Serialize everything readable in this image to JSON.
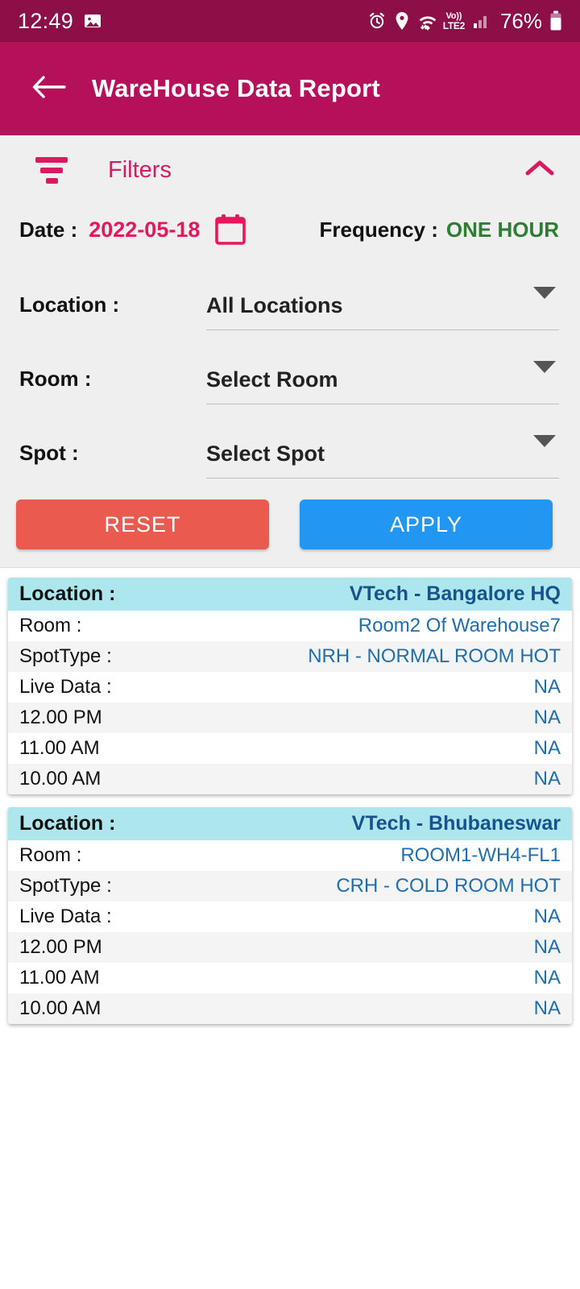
{
  "status_bar": {
    "time": "12:49",
    "icons_left": [
      "image-icon"
    ],
    "icons_right": [
      "alarm-icon",
      "location-pin-icon",
      "wifi-icon",
      "volte-icon",
      "signal-bars-icon",
      "battery-icon"
    ],
    "volte_top": "Vo))",
    "volte_bottom": "LTE2",
    "battery_percent": "76%"
  },
  "app_bar": {
    "back_icon": "back-arrow-icon",
    "title": "WareHouse Data Report",
    "background": "#B5115A"
  },
  "filters": {
    "icon": "filter-icon",
    "title": "Filters",
    "collapse_icon": "chevron-up-icon",
    "date": {
      "label": "Date :",
      "value": "2022-05-18",
      "icon": "calendar-icon",
      "color": "#E8175D"
    },
    "frequency": {
      "label": "Frequency :",
      "value": "ONE HOUR",
      "color": "#2E7D32"
    },
    "selects": [
      {
        "label": "Location :",
        "value": "All Locations",
        "caret": "caret-down-icon"
      },
      {
        "label": "Room :",
        "value": "Select Room",
        "caret": "caret-down-icon"
      },
      {
        "label": "Spot :",
        "value": "Select Spot",
        "caret": "caret-down-icon"
      }
    ],
    "buttons": {
      "reset": "RESET",
      "apply": "APPLY",
      "reset_color": "#EB5A4E",
      "apply_color": "#2196F3"
    }
  },
  "results": {
    "cards": [
      {
        "header": {
          "key": "Location :",
          "value": "VTech - Bangalore HQ"
        },
        "rows": [
          {
            "key": "Room :",
            "value": "Room2 Of Warehouse7"
          },
          {
            "key": "SpotType :",
            "value": "NRH - NORMAL ROOM HOT"
          },
          {
            "key": "Live Data :",
            "value": "NA"
          },
          {
            "key": "12.00 PM",
            "value": "NA"
          },
          {
            "key": "11.00 AM",
            "value": "NA"
          },
          {
            "key": "10.00 AM",
            "value": "NA"
          }
        ]
      },
      {
        "header": {
          "key": "Location :",
          "value": "VTech - Bhubaneswar"
        },
        "rows": [
          {
            "key": "Room :",
            "value": "ROOM1-WH4-FL1"
          },
          {
            "key": "SpotType :",
            "value": "CRH - COLD ROOM HOT"
          },
          {
            "key": "Live Data :",
            "value": "NA"
          },
          {
            "key": "12.00 PM",
            "value": "NA"
          },
          {
            "key": "11.00 AM",
            "value": "NA"
          },
          {
            "key": "10.00 AM",
            "value": "NA"
          }
        ]
      }
    ]
  }
}
